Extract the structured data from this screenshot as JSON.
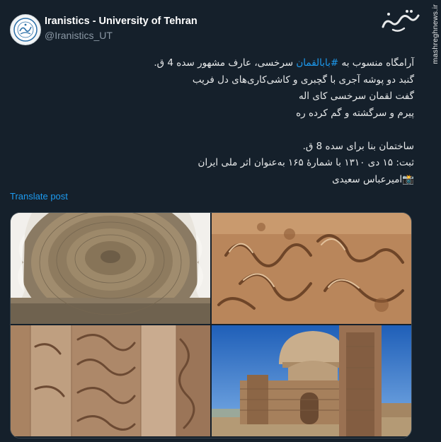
{
  "account": {
    "name": "Iranistics - University of Tehran",
    "handle": "@Iranistics_UT",
    "avatar_icon": "university-seal-icon"
  },
  "watermark": {
    "logo_text": "مشرق",
    "site": "mashreghnews.ir"
  },
  "tweet": {
    "line1_before": "آرامگاه منسوب به ",
    "line1_hashtag": "#بابالقمان",
    "line1_after": " سرخسی، عارف مشهور سده 4 ق.",
    "line2": "گنبد دو پوشه آجری با گچبری و کاشی‌کاری‌های دل فریب",
    "line3": "گفت لقمان سرخسی کای اله",
    "line4": "پیرم و سرگشته و گم کرده ره",
    "line5": "ساختمان بنا برای سده 8 ق.",
    "line6": "ثبت: ۱۵ دی ۱۳۱۰ با شمارهٔ ۱۶۵ به‌عنوان اثر ملی ایران",
    "line7_emoji": "📸",
    "line7": "امیرعباس سعیدی"
  },
  "translate_label": "Translate post",
  "media": [
    {
      "name": "dome-interior-photo"
    },
    {
      "name": "stucco-calligraphy-photo"
    },
    {
      "name": "carved-wall-photo"
    },
    {
      "name": "mausoleum-exterior-photo"
    }
  ],
  "colors": {
    "background": "#15202b",
    "link": "#1d9bf0",
    "muted": "#8b98a5"
  }
}
